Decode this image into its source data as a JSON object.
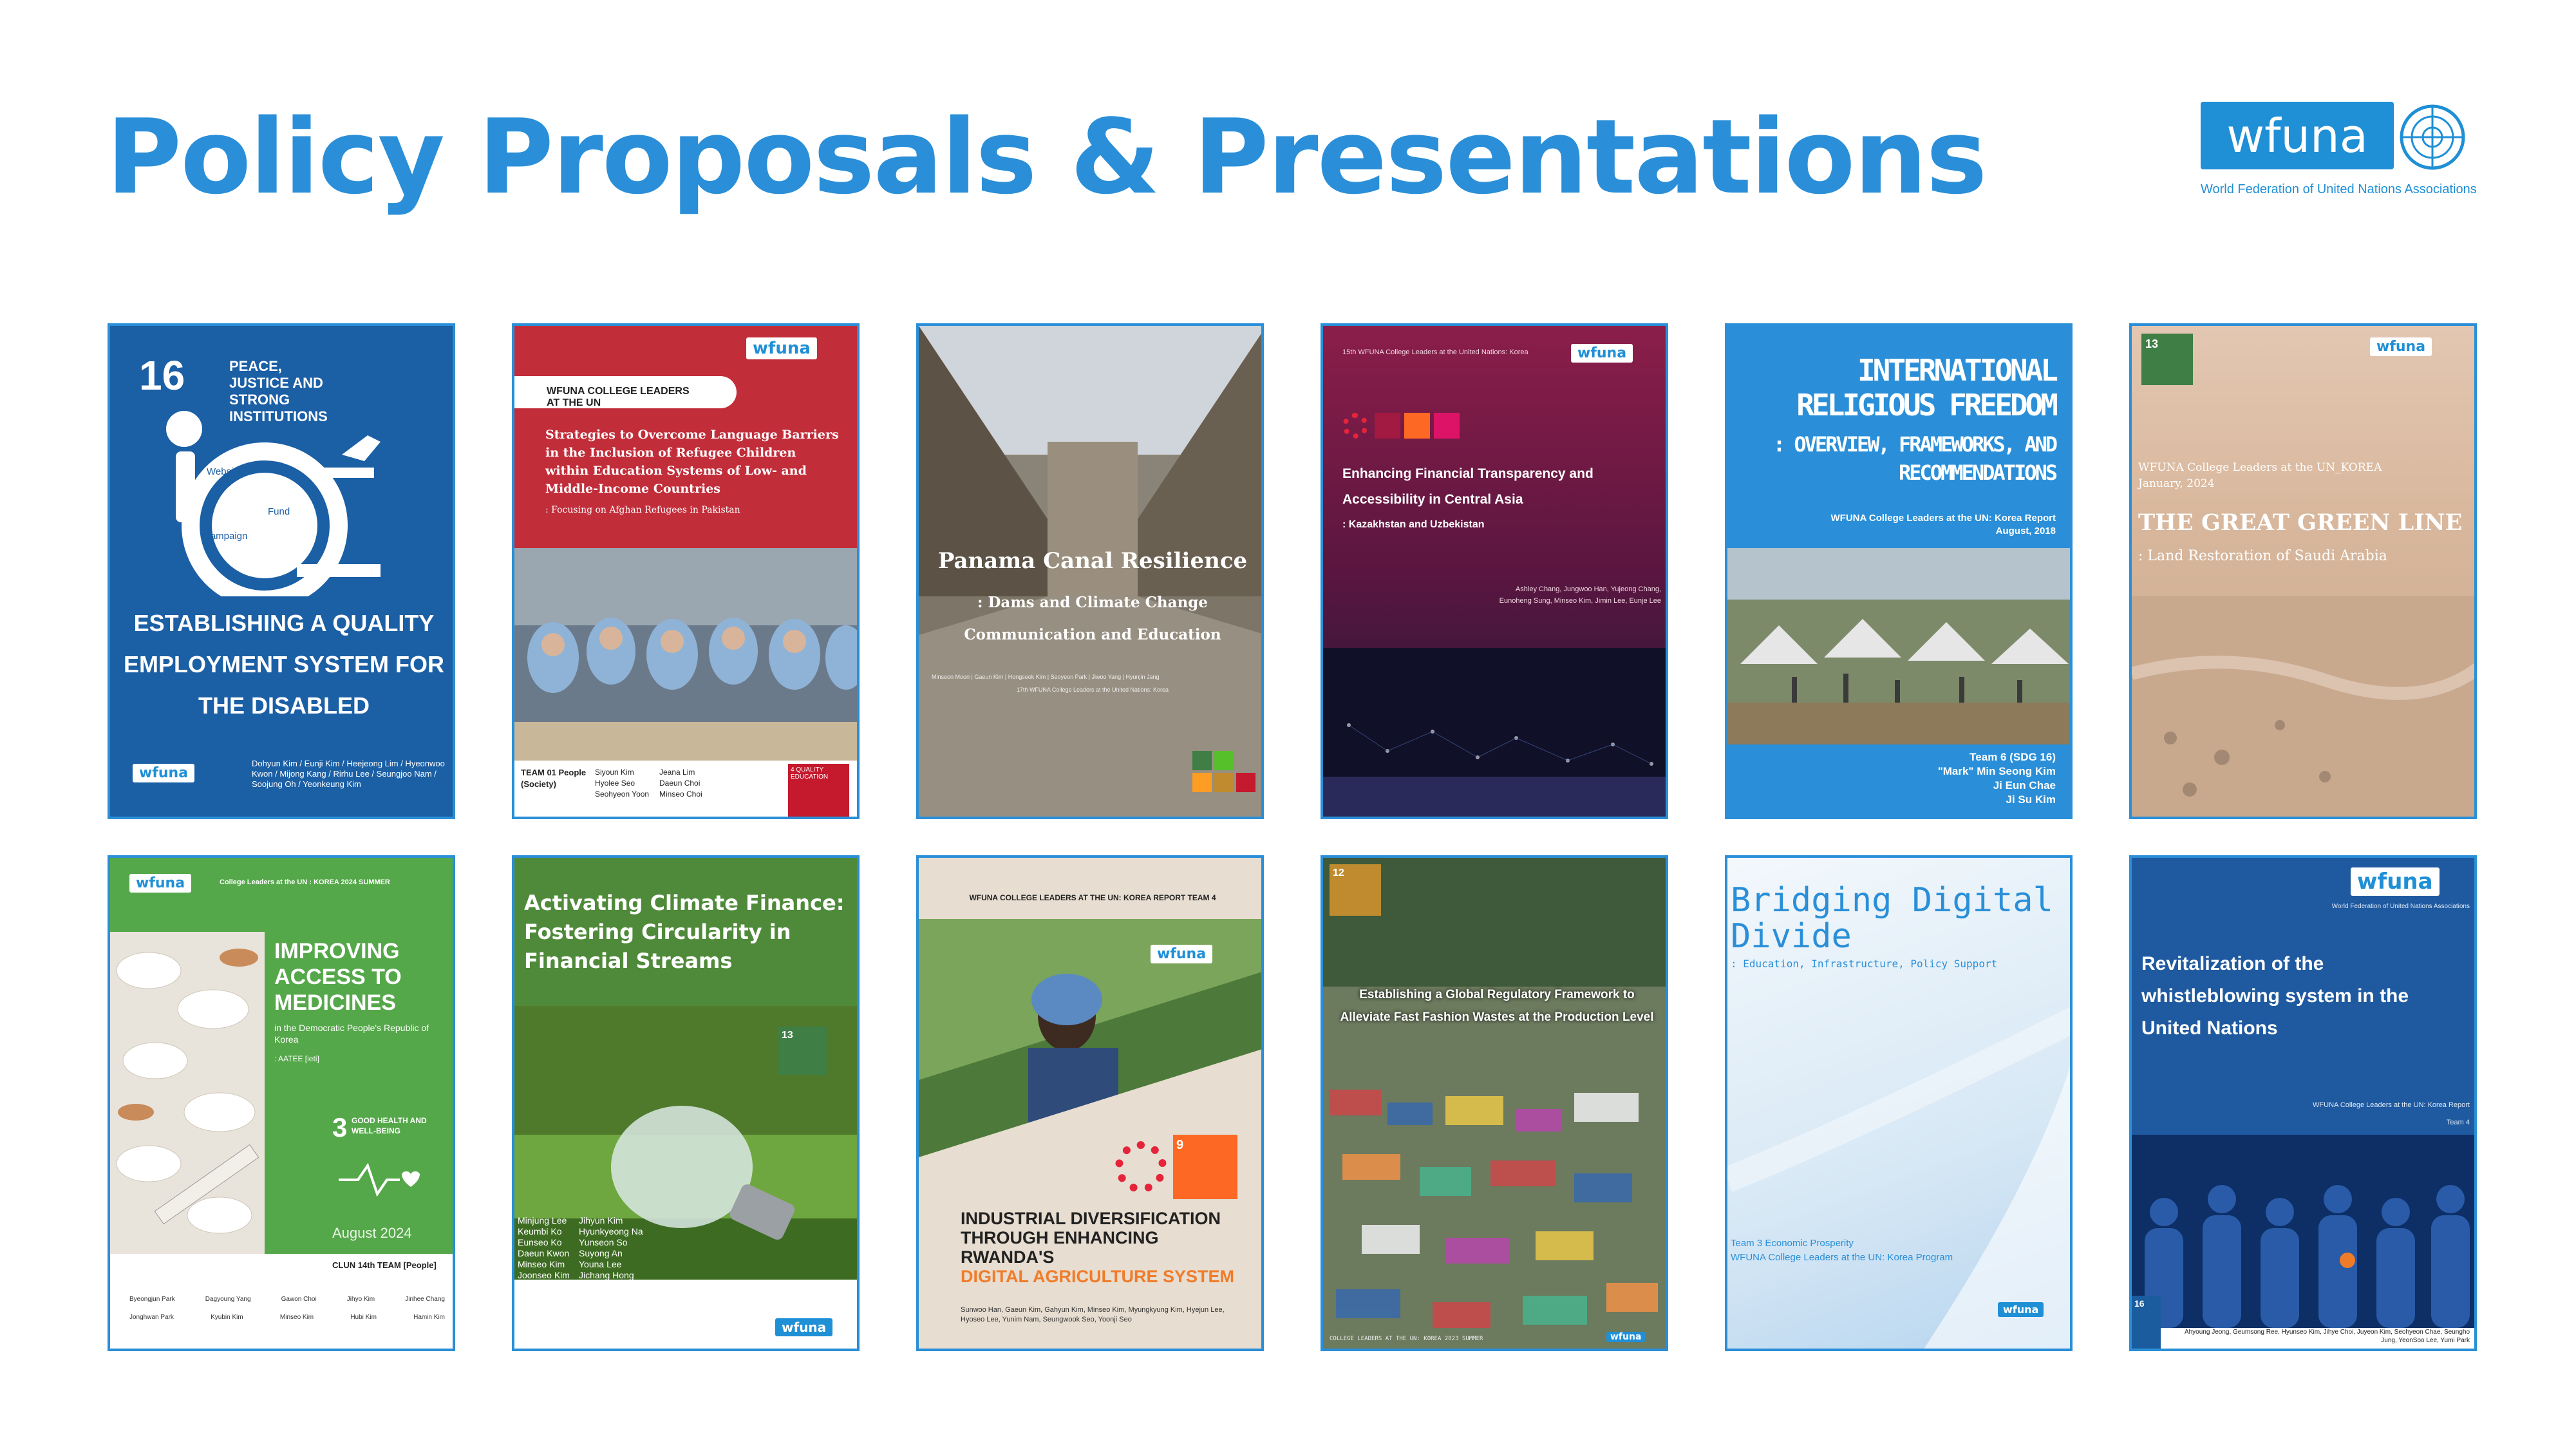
{
  "header": {
    "title": "Policy Proposals & Presentations",
    "logo_text": "wfuna",
    "logo_tagline": "World Federation of United Nations Associations"
  },
  "cards": [
    {
      "sdg_number": "16",
      "sdg_text": "PEACE, JUSTICE AND STRONG INSTITUTIONS",
      "bubbles": [
        "Website",
        "Fund",
        "Campaign"
      ],
      "title": "ESTABLISHING A QUALITY EMPLOYMENT SYSTEM FOR THE DISABLED",
      "logo": "wfuna",
      "authors": "Dohyun Kim / Eunji Kim / Heejeong Lim / Hyeonwoo Kwon / Mijong Kang / Rirhu Lee / Seungjoo Nam / Soojung Oh / Yeonkeung Kim"
    },
    {
      "logo": "wfuna",
      "banner": "WFUNA COLLEGE LEADERS AT THE UN",
      "title": "Strategies to Overcome Language Barriers in the Inclusion of Refugee Children within Education Systems of Low- and Middle-Income Countries",
      "subtitle": ": Focusing on Afghan Refugees in Pakistan",
      "team": "TEAM 01 People (Society)",
      "names_col1": "Siyoun Kim\nHyolee Seo\nSeohyeon Yoon",
      "names_col2": "Jeana Lim\nDaeun Choi\nMinseo Choi",
      "sdg_label": "4 QUALITY EDUCATION"
    },
    {
      "title": "Panama Canal Resilience",
      "subtitle": ": Dams and Climate Change Communication and Education",
      "authors": "Minseon Moon | Gaeun Kim | Hongseok Kim | Seoyeon Park | Jiwoo Yang | Hyunjin Jang",
      "footer": "17th WFUNA College Leaders at the United Nations: Korea"
    },
    {
      "header": "15th WFUNA College Leaders at the United Nations: Korea",
      "logo": "wfuna",
      "title": "Enhancing Financial Transparency and Accessibility in Central Asia",
      "subtitle": ": Kazakhstan and Uzbekistan",
      "authors": "Ashley Chang, Jungwoo Han, Yujeong Chang, Eunoheng Sung, Minseo Kim, Jimin Lee, Eunje Lee"
    },
    {
      "title": "INTERNATIONAL RELIGIOUS FREEDOM",
      "subtitle": ": OVERVIEW, FRAMEWORKS, AND RECOMMENDATIONS",
      "report": "WFUNA College Leaders at the UN: Korea Report",
      "date": "August, 2018",
      "team": "Team 6 (SDG 16)",
      "members": [
        "\"Mark\" Min Seong Kim",
        "Ji Eun Chae",
        "Ji Su Kim"
      ]
    },
    {
      "sdg_number": "13",
      "logo": "wfuna",
      "header": "WFUNA College Leaders at the UN_KOREA",
      "date": "January, 2024",
      "title": "THE GREAT GREEN LINE",
      "subtitle": ": Land Restoration of Saudi Arabia"
    },
    {
      "logo": "wfuna",
      "header": "College Leaders at the UN : KOREA 2024 SUMMER",
      "title": "IMPROVING ACCESS TO MEDICINES",
      "subtitle": "in the Democratic People's Republic of Korea",
      "tag": ": AATEE [ieti]",
      "sdg_number": "3",
      "sdg_text": "GOOD HEALTH AND WELL-BEING",
      "date": "August 2024",
      "team": "CLUN 14th TEAM [People]",
      "names_row1": [
        "Byeongjun Park",
        "Dagyoung Yang",
        "Gawon Choi",
        "Jihyo Kim",
        "Jinhee Chang"
      ],
      "names_row2": [
        "Jonghwan Park",
        "Kyubin Kim",
        "Minseo Kim",
        "Hubi Kim",
        "Hamin Kim"
      ]
    },
    {
      "title": "Activating Climate Finance: Fostering Circularity in Financial Streams",
      "sdg_number": "13",
      "names_col1": "Minjung Lee\nKeumbi Ko\nEunseo Ko\nDaeun Kwon\nMinseo Kim\nJoonseo Kim",
      "names_col2": "Jihyun Kim\nHyunkyeong Na\nYunseon So\nSuyong An\nYouna Lee\nJichang Hong",
      "logo": "wfuna"
    },
    {
      "header": "WFUNA COLLEGE LEADERS AT THE UN: KOREA REPORT TEAM 4",
      "logo": "wfuna",
      "title_line1": "INDUSTRIAL DIVERSIFICATION THROUGH ENHANCING RWANDA'S",
      "title_highlight": "DIGITAL AGRICULTURE SYSTEM",
      "sdg_number": "9",
      "authors": "Sunwoo Han, Gaeun Kim, Gahyun Kim, Minseo Kim, Myungkyung Kim, Hyejun Lee, Hyoseo Lee, Yunim Nam, Seungwook Seo, Yoonji Seo"
    },
    {
      "sdg_number": "12",
      "title": "Establishing a Global Regulatory Framework to Alleviate Fast Fashion Wastes at the Production Level",
      "footer": "COLLEGE LEADERS AT THE UN: KOREA 2023 SUMMER",
      "logo": "wfuna"
    },
    {
      "title": "Bridging Digital Divide",
      "subtitle": ": Education, Infrastructure, Policy Support",
      "team": "Team 3 Economic Prosperity",
      "program": "WFUNA College Leaders at the UN: Korea Program",
      "logo": "wfuna"
    },
    {
      "logo": "wfuna",
      "tagline": "World Federation of United Nations Associations",
      "title": "Revitalization of the whistleblowing system in the United Nations",
      "report": "WFUNA College Leaders at the UN: Korea Report",
      "team": "Team 4",
      "sdg_number": "16",
      "authors": "Ahyoung Jeong, Geumsong Ree, Hyunseo Kim, Jihye Choi, Juyeon Kim, Seohyeon Chae, Seungho Jung, YeonSoo Lee, Yumi Park"
    }
  ],
  "colors": {
    "accent": "#2a8fd8",
    "sdg16": "#1a5c9e",
    "sdg13": "#3f7e44",
    "sdg4": "#c5192d",
    "sdg3": "#4c9f38"
  }
}
